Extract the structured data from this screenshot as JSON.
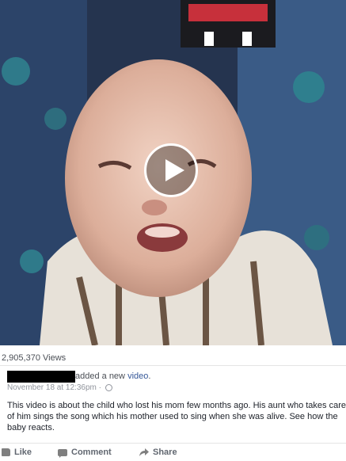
{
  "video": {
    "play_icon": "play-icon"
  },
  "stats": {
    "views": "2,905,370 Views"
  },
  "post": {
    "added_text": "added a new ",
    "link_text": "video",
    "period": ".",
    "timestamp": "November 18 at 12:36pm · ",
    "privacy_icon": "globe-icon",
    "description": "This video is about the child who lost his mom few months ago. His aunt who takes care of him sings the song which his mother used to sing when she was alive. See how the baby reacts."
  },
  "actions": {
    "like": "Like",
    "comment": "Comment",
    "share": "Share"
  },
  "colors": {
    "link": "#365899",
    "muted": "#90949c",
    "action_text": "#616770"
  }
}
